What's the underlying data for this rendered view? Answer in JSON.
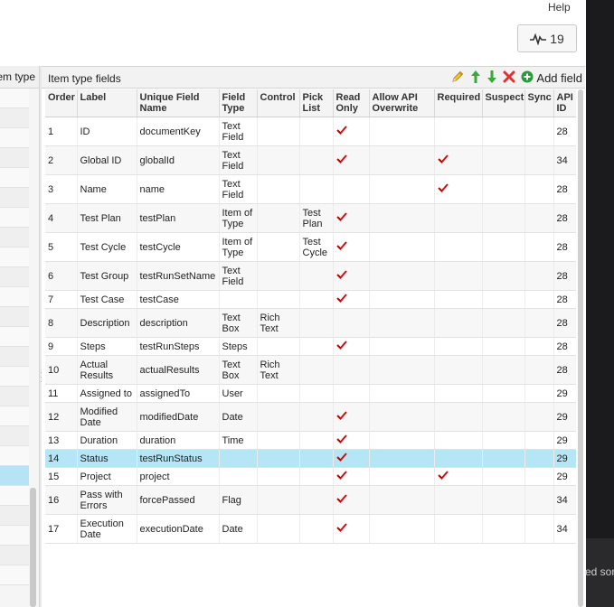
{
  "header": {
    "help_label": "Help",
    "activity_count": "19"
  },
  "left_panel": {
    "header_text": "em type"
  },
  "dark_panel": {
    "partial_text": "ed son"
  },
  "panel": {
    "title": "Item type fields",
    "add_field_label": "Add field"
  },
  "columns": [
    "Order",
    "Label",
    "Unique Field Name",
    "Field Type",
    "Control",
    "Pick List",
    "Read Only",
    "Allow API Overwrite",
    "Required",
    "Suspect",
    "Sync",
    "API ID"
  ],
  "rows": [
    {
      "order": "1",
      "label": "ID",
      "unique": "documentKey",
      "type": "Text Field",
      "control": "",
      "pick": "",
      "read_only": true,
      "required": false,
      "api_id": "28"
    },
    {
      "order": "2",
      "label": "Global ID",
      "unique": "globalId",
      "type": "Text Field",
      "control": "",
      "pick": "",
      "read_only": true,
      "required": true,
      "api_id": "34"
    },
    {
      "order": "3",
      "label": "Name",
      "unique": "name",
      "type": "Text Field",
      "control": "",
      "pick": "",
      "read_only": false,
      "required": true,
      "api_id": "28"
    },
    {
      "order": "4",
      "label": "Test Plan",
      "unique": "testPlan",
      "type": "Item of Type",
      "control": "",
      "pick": "Test Plan",
      "read_only": true,
      "required": false,
      "api_id": "28"
    },
    {
      "order": "5",
      "label": "Test Cycle",
      "unique": "testCycle",
      "type": "Item of Type",
      "control": "",
      "pick": "Test Cycle",
      "read_only": true,
      "required": false,
      "api_id": "28"
    },
    {
      "order": "6",
      "label": "Test Group",
      "unique": "testRunSetName",
      "type": "Text Field",
      "control": "",
      "pick": "",
      "read_only": true,
      "required": false,
      "api_id": "28"
    },
    {
      "order": "7",
      "label": "Test Case",
      "unique": "testCase",
      "type": "",
      "control": "",
      "pick": "",
      "read_only": true,
      "required": false,
      "api_id": "28"
    },
    {
      "order": "8",
      "label": "Description",
      "unique": "description",
      "type": "Text Box",
      "control": "Rich Text",
      "pick": "",
      "read_only": false,
      "required": false,
      "api_id": "28"
    },
    {
      "order": "9",
      "label": "Steps",
      "unique": "testRunSteps",
      "type": "Steps",
      "control": "",
      "pick": "",
      "read_only": true,
      "required": false,
      "api_id": "28"
    },
    {
      "order": "10",
      "label": "Actual Results",
      "unique": "actualResults",
      "type": "Text Box",
      "control": "Rich Text",
      "pick": "",
      "read_only": false,
      "required": false,
      "api_id": "28"
    },
    {
      "order": "11",
      "label": "Assigned to",
      "unique": "assignedTo",
      "type": "User",
      "control": "",
      "pick": "",
      "read_only": false,
      "required": false,
      "api_id": "29"
    },
    {
      "order": "12",
      "label": "Modified Date",
      "unique": "modifiedDate",
      "type": "Date",
      "control": "",
      "pick": "",
      "read_only": true,
      "required": false,
      "api_id": "29"
    },
    {
      "order": "13",
      "label": "Duration",
      "unique": "duration",
      "type": "Time",
      "control": "",
      "pick": "",
      "read_only": true,
      "required": false,
      "api_id": "29"
    },
    {
      "order": "14",
      "label": "Status",
      "unique": "testRunStatus",
      "type": "",
      "control": "",
      "pick": "",
      "read_only": true,
      "required": false,
      "api_id": "29"
    },
    {
      "order": "15",
      "label": "Project",
      "unique": "project",
      "type": "",
      "control": "",
      "pick": "",
      "read_only": true,
      "required": true,
      "api_id": "29"
    },
    {
      "order": "16",
      "label": "Pass with Errors",
      "unique": "forcePassed",
      "type": "Flag",
      "control": "",
      "pick": "",
      "read_only": true,
      "required": false,
      "api_id": "34"
    },
    {
      "order": "17",
      "label": "Execution Date",
      "unique": "executionDate",
      "type": "Date",
      "control": "",
      "pick": "",
      "read_only": true,
      "required": false,
      "api_id": "34"
    }
  ],
  "selected_row_order": "14",
  "colors": {
    "selected_row": "#b4e6f5",
    "check_red": "#cc1111",
    "edit_yellow": "#e8b923",
    "move_green": "#2f9e2f",
    "delete_red": "#e03030",
    "add_green": "#2a9a3a"
  },
  "icons": {
    "activity": "pulse-icon",
    "edit": "pencil-icon",
    "move_up": "arrow-up-icon",
    "move_down": "arrow-down-icon",
    "delete": "x-icon",
    "add": "plus-circle-icon",
    "check": "checkmark-icon"
  }
}
